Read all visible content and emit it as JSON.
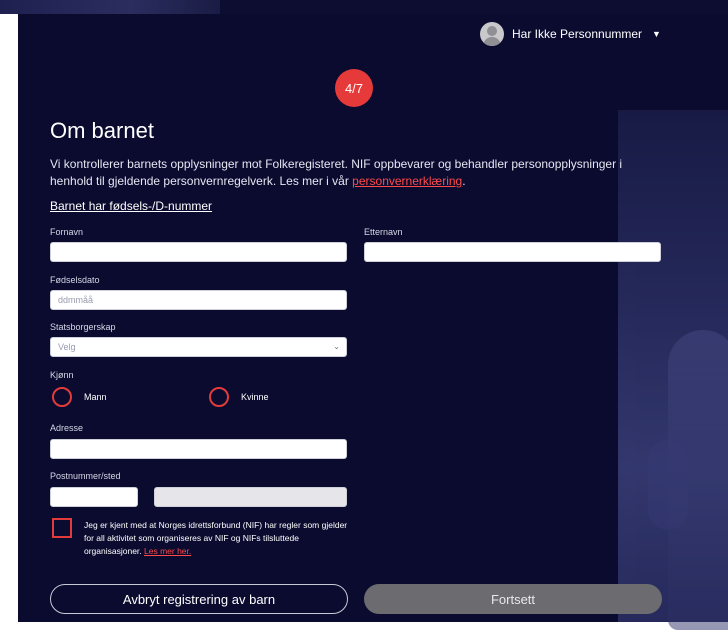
{
  "header": {
    "user_name": "Har Ikke Personnummer",
    "step_badge": "4/7"
  },
  "main": {
    "title": "Om barnet",
    "intro_text": "Vi kontrollerer barnets opplysninger mot Folkeregisteret. NIF oppbevarer og behandler personopplysninger i henhold til gjeldende personvernregelverk. Les mer i vår ",
    "intro_link": "personvernerklæring",
    "intro_suffix": ".",
    "toggle_link": "Barnet har fødsels-/D-nummer"
  },
  "form": {
    "first_name_label": "Fornavn",
    "last_name_label": "Etternavn",
    "birth_date_label": "Fødselsdato",
    "birth_date_placeholder": "ddmmåå",
    "citizenship_label": "Statsborgerskap",
    "citizenship_selected": "Velg",
    "gender_label": "Kjønn",
    "gender_options": [
      "Mann",
      "Kvinne"
    ],
    "address_label": "Adresse",
    "postal_label": "Postnummer/sted"
  },
  "consent": {
    "text": "Jeg er kjent med at Norges idrettsforbund (NIF) har regler som gjelder for all aktivitet som organiseres av NIF og NIFs tilsluttede organisasjoner. ",
    "link": "Les mer her."
  },
  "buttons": {
    "cancel": "Avbryt registrering av barn",
    "next": "Fortsett"
  },
  "colors": {
    "background": "#0a0b2f",
    "accent": "#e63a3a",
    "disabled_button": "#6b6b70"
  }
}
